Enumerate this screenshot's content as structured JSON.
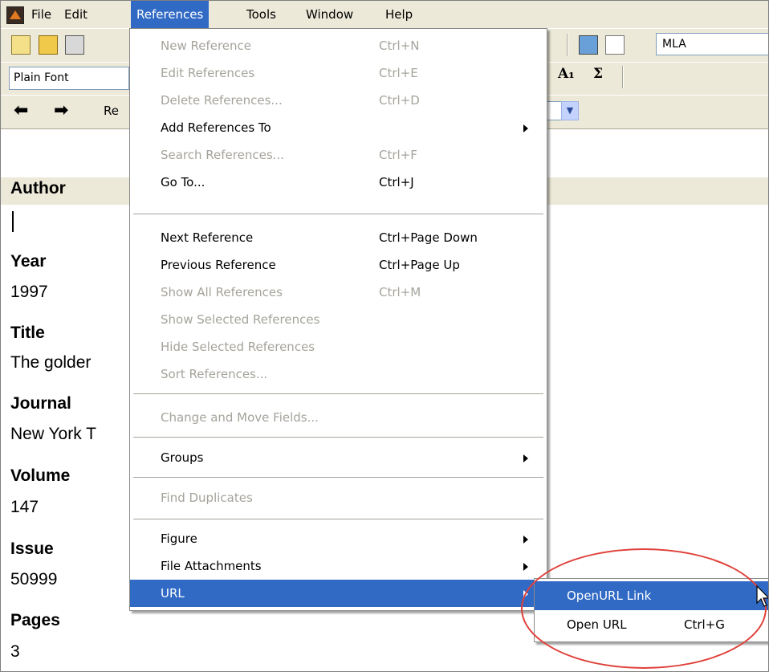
{
  "menubar": {
    "items": [
      "File",
      "Edit",
      "References",
      "Tools",
      "Window",
      "Help"
    ]
  },
  "toolbar": {
    "output_style": "MLA",
    "font": "Plain Font",
    "subscript_label": "A₁",
    "sigma_label": "Σ",
    "ref_label": "Re"
  },
  "record": {
    "author_label": "Author",
    "author_value": "",
    "year_label": "Year",
    "year_value": "1997",
    "title_label": "Title",
    "title_value": "The golder",
    "journal_label": "Journal",
    "journal_value": "New York T",
    "volume_label": "Volume",
    "volume_value": "147",
    "issue_label": "Issue",
    "issue_value": "50999",
    "pages_label": "Pages",
    "pages_value": "3"
  },
  "references_menu": {
    "items": [
      {
        "label": "New Reference",
        "shortcut": "Ctrl+N",
        "enabled": false
      },
      {
        "label": "Edit References",
        "shortcut": "Ctrl+E",
        "enabled": false
      },
      {
        "label": "Delete References...",
        "shortcut": "Ctrl+D",
        "enabled": false
      },
      {
        "label": "Add References To",
        "shortcut": "",
        "enabled": true,
        "submenu": true
      },
      {
        "label": "Search References...",
        "shortcut": "Ctrl+F",
        "enabled": false
      },
      {
        "label": "Go To...",
        "shortcut": "Ctrl+J",
        "enabled": true
      },
      {
        "label": "Next Reference",
        "shortcut": "Ctrl+Page Down",
        "enabled": true
      },
      {
        "label": "Previous Reference",
        "shortcut": "Ctrl+Page Up",
        "enabled": true
      },
      {
        "label": "Show All References",
        "shortcut": "Ctrl+M",
        "enabled": false
      },
      {
        "label": "Show Selected References",
        "shortcut": "",
        "enabled": false
      },
      {
        "label": "Hide Selected References",
        "shortcut": "",
        "enabled": false
      },
      {
        "label": "Sort References...",
        "shortcut": "",
        "enabled": false
      },
      {
        "label": "Change and Move Fields...",
        "shortcut": "",
        "enabled": false
      },
      {
        "label": "Groups",
        "shortcut": "",
        "enabled": true,
        "submenu": true
      },
      {
        "label": "Find Duplicates",
        "shortcut": "",
        "enabled": false
      },
      {
        "label": "Figure",
        "shortcut": "",
        "enabled": true,
        "submenu": true
      },
      {
        "label": "File Attachments",
        "shortcut": "",
        "enabled": true,
        "submenu": true
      },
      {
        "label": "URL",
        "shortcut": "",
        "enabled": true,
        "submenu": true,
        "highlighted": true
      }
    ]
  },
  "url_submenu": {
    "items": [
      {
        "label": "OpenURL Link",
        "shortcut": "",
        "highlighted": true
      },
      {
        "label": "Open URL",
        "shortcut": "Ctrl+G"
      }
    ]
  },
  "colors": {
    "highlight": "#316ac5",
    "chrome": "#ece9d8",
    "disabled_text": "#a5a39b",
    "annotation_oval": "#e0403a"
  }
}
